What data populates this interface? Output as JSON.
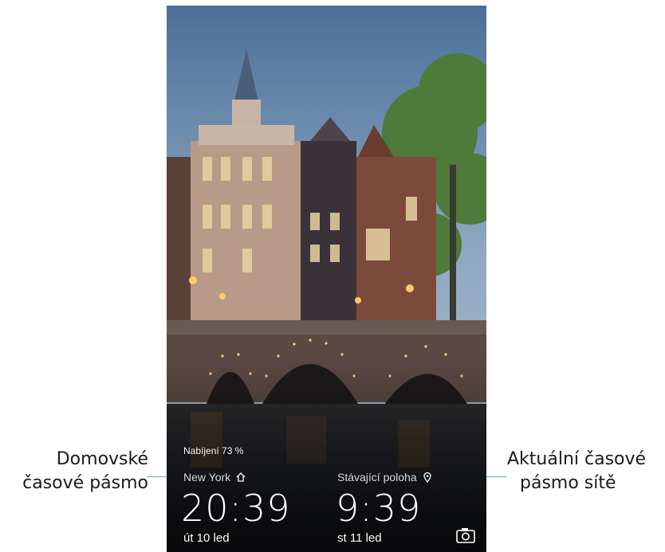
{
  "callouts": {
    "home_line1": "Domovské",
    "home_line2": "časové pásmo",
    "network_line1": "Aktuální časové",
    "network_line2": "pásmo sítě"
  },
  "lockscreen": {
    "charging": "Nabíjení 73 %",
    "home_city": "New York",
    "home_time": "20:39",
    "home_date": "út 10 led",
    "current_location": "Stávající poloha",
    "current_time": "9:39",
    "current_date": "st 11 led"
  },
  "icons": {
    "home": "home-icon",
    "location": "location-pin-icon",
    "camera": "camera-icon"
  },
  "colors": {
    "leader_line": "#6aa6a6",
    "text_on_wallpaper": "#ffffff"
  }
}
